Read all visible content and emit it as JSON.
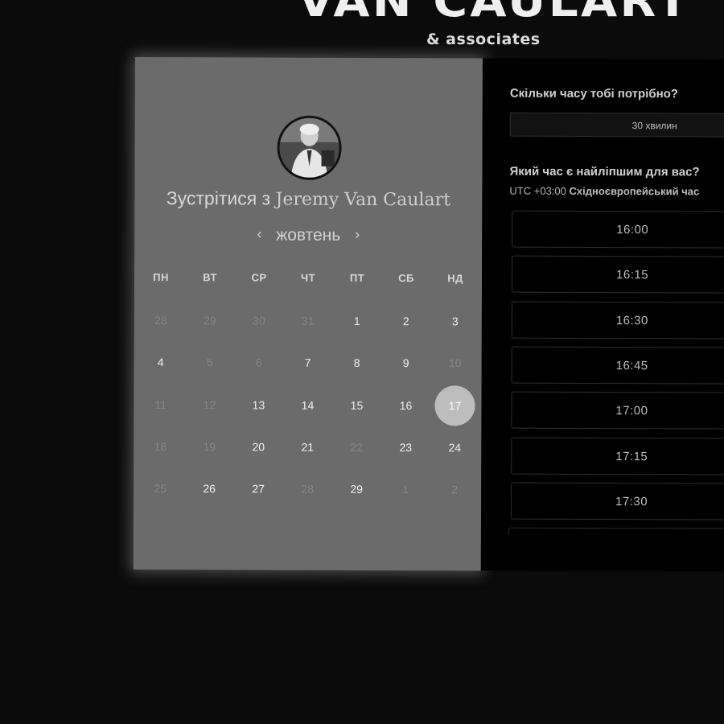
{
  "brand": {
    "title": "VAN CAULART",
    "subtitle": "& associates"
  },
  "calendar": {
    "title_prefix": "Зустрітися з",
    "host_name": "Jeremy Van Caulart",
    "month": "жовтень",
    "prev_arrow": "‹",
    "next_arrow": "›",
    "weekdays": [
      "ПН",
      "ВТ",
      "СР",
      "ЧТ",
      "ПТ",
      "СБ",
      "НД"
    ],
    "weeks": [
      [
        {
          "d": "28",
          "muted": true
        },
        {
          "d": "29",
          "muted": true
        },
        {
          "d": "30",
          "muted": true
        },
        {
          "d": "31",
          "muted": true
        },
        {
          "d": "1",
          "muted": false
        },
        {
          "d": "2",
          "muted": false
        },
        {
          "d": "3",
          "muted": false
        }
      ],
      [
        {
          "d": "4",
          "muted": false
        },
        {
          "d": "5",
          "muted": true
        },
        {
          "d": "6",
          "muted": true
        },
        {
          "d": "7",
          "muted": false
        },
        {
          "d": "8",
          "muted": false
        },
        {
          "d": "9",
          "muted": false
        },
        {
          "d": "10",
          "muted": true
        }
      ],
      [
        {
          "d": "11",
          "muted": true
        },
        {
          "d": "12",
          "muted": true
        },
        {
          "d": "13",
          "muted": false
        },
        {
          "d": "14",
          "muted": false
        },
        {
          "d": "15",
          "muted": false
        },
        {
          "d": "16",
          "muted": false
        },
        {
          "d": "17",
          "muted": false,
          "selected": true
        }
      ],
      [
        {
          "d": "18",
          "muted": true
        },
        {
          "d": "19",
          "muted": true
        },
        {
          "d": "20",
          "muted": false
        },
        {
          "d": "21",
          "muted": false
        },
        {
          "d": "22",
          "muted": true
        },
        {
          "d": "23",
          "muted": false
        },
        {
          "d": "24",
          "muted": false
        }
      ],
      [
        {
          "d": "25",
          "muted": true
        },
        {
          "d": "26",
          "muted": false
        },
        {
          "d": "27",
          "muted": false
        },
        {
          "d": "28",
          "muted": true
        },
        {
          "d": "29",
          "muted": false
        },
        {
          "d": "1",
          "muted": true
        },
        {
          "d": "2",
          "muted": true
        }
      ]
    ]
  },
  "booking": {
    "duration_question": "Скільки часу тобі потрібно?",
    "duration_value": "30 хвилин",
    "time_question": "Який час є найліпшим для вас?",
    "timezone_offset": "UTC +03:00",
    "timezone_name": "Східноєвропейський час",
    "slots": [
      "16:00",
      "16:15",
      "16:30",
      "16:45",
      "17:00",
      "17:15",
      "17:30"
    ]
  },
  "colors": {
    "panel": "#6b6b6b",
    "selected_day": "#bdbdbd",
    "background": "#0b0b0b"
  }
}
